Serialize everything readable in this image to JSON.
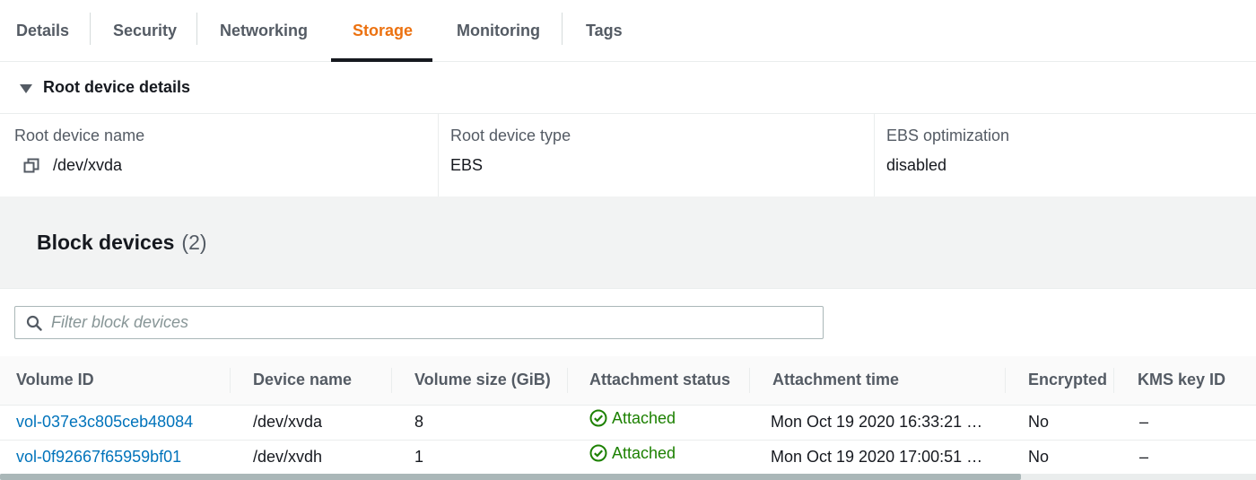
{
  "tabs": [
    {
      "label": "Details"
    },
    {
      "label": "Security"
    },
    {
      "label": "Networking"
    },
    {
      "label": "Storage",
      "active": true
    },
    {
      "label": "Monitoring"
    },
    {
      "label": "Tags"
    }
  ],
  "root_device": {
    "section_title": "Root device details",
    "name_label": "Root device name",
    "name_value": "/dev/xvda",
    "type_label": "Root device type",
    "type_value": "EBS",
    "ebs_label": "EBS optimization",
    "ebs_value": "disabled"
  },
  "block_devices": {
    "title": "Block devices",
    "count": "(2)",
    "filter_placeholder": "Filter block devices",
    "columns": [
      "Volume ID",
      "Device name",
      "Volume size (GiB)",
      "Attachment status",
      "Attachment time",
      "Encrypted",
      "KMS key ID"
    ],
    "rows": [
      {
        "volume_id": "vol-037e3c805ceb48084",
        "device": "/dev/xvda",
        "size": "8",
        "status": "Attached",
        "time": "Mon Oct 19 2020 16:33:21 …",
        "encrypted": "No",
        "kms": "–"
      },
      {
        "volume_id": "vol-0f92667f65959bf01",
        "device": "/dev/xvdh",
        "size": "1",
        "status": "Attached",
        "time": "Mon Oct 19 2020 17:00:51 …",
        "encrypted": "No",
        "kms": "–"
      }
    ]
  },
  "colors": {
    "accent": "#ec7211",
    "link": "#0073bb",
    "success": "#1d8102",
    "text": "#16191f",
    "muted": "#545b64"
  }
}
